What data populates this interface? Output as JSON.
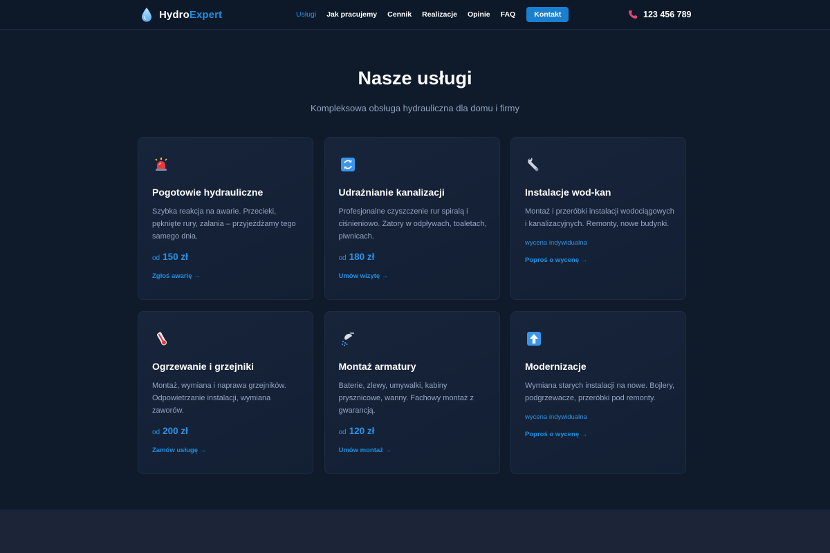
{
  "brand": {
    "name_a": "Hydro",
    "name_b": "Expert"
  },
  "nav": {
    "items": [
      {
        "label": "Usługi",
        "active": true
      },
      {
        "label": "Jak pracujemy"
      },
      {
        "label": "Cennik"
      },
      {
        "label": "Realizacje"
      },
      {
        "label": "Opinie"
      },
      {
        "label": "FAQ"
      }
    ],
    "cta_label": "Kontakt"
  },
  "phone": {
    "number": "123 456 789"
  },
  "colors": {
    "accent": "#1e8fe0",
    "background": "#0f1a2b",
    "card": "#15223a",
    "phone_icon": "#e0457b"
  },
  "section": {
    "title": "Nasze usługi",
    "subtitle": "Kompleksowa obsługa hydrauliczna dla domu i firmy"
  },
  "cards": [
    {
      "icon": "siren-icon",
      "title": "Pogotowie hydrauliczne",
      "desc": "Szybka reakcja na awarie. Przecieki, pęknięte rury, zalania – przyjeżdżamy tego samego dnia.",
      "price_prefix": "od",
      "price": "150 zł",
      "link": "Zgłoś awarię →"
    },
    {
      "icon": "refresh-icon",
      "title": "Udrażnianie kanalizacji",
      "desc": "Profesjonalne czyszczenie rur spiralą i ciśnieniowo. Zatory w odpływach, toaletach, piwnicach.",
      "price_prefix": "od",
      "price": "180 zł",
      "link": "Umów wizytę →"
    },
    {
      "icon": "wrench-icon",
      "title": "Instalacje wod-kan",
      "desc": "Montaż i przeróbki instalacji wodociągowych i kanalizacyjnych. Remonty, nowe budynki.",
      "quote": "wycena indywidualna",
      "link": "Poproś o wycenę →"
    },
    {
      "icon": "thermometer-icon",
      "title": "Ogrzewanie i grzejniki",
      "desc": "Montaż, wymiana i naprawa grzejników. Odpowietrzanie instalacji, wymiana zaworów.",
      "price_prefix": "od",
      "price": "200 zł",
      "link": "Zamów usługę →"
    },
    {
      "icon": "shower-icon",
      "title": "Montaż armatury",
      "desc": "Baterie, zlewy, umywalki, kabiny prysznicowe, wanny. Fachowy montaż z gwarancją.",
      "price_prefix": "od",
      "price": "120 zł",
      "link": "Umów montaż →"
    },
    {
      "icon": "arrow-up-icon",
      "title": "Modernizacje",
      "desc": "Wymiana starych instalacji na nowe. Bojlery, podgrzewacze, przeróbki pod remonty.",
      "quote": "wycena indywidualna",
      "link": "Poproś o wycenę →"
    }
  ]
}
